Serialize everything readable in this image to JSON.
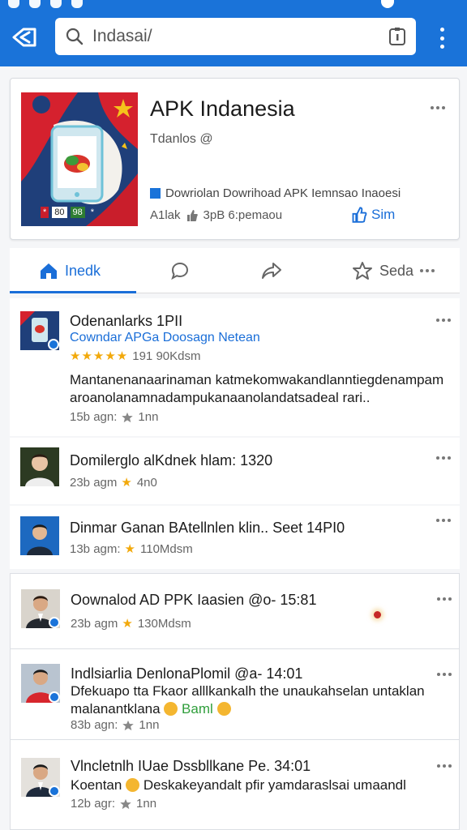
{
  "search": {
    "value": "Indasai/"
  },
  "app": {
    "title": "APK Indanesia",
    "subtitle": "Tdanlos @",
    "description": "Dowriolan  Dowrihoad APK  Iemnsao Inaoesi",
    "rating": "A1lak",
    "size": "3pB 6:pemaou",
    "action_label": "Sim",
    "art_chips": [
      "*",
      "80",
      "98",
      "*"
    ]
  },
  "tabs": [
    {
      "label": "Inedk",
      "icon": "home-icon",
      "active": true
    },
    {
      "label": "",
      "icon": "chat-icon"
    },
    {
      "label": "",
      "icon": "share-icon"
    },
    {
      "label": "Seda",
      "icon": "star-icon"
    }
  ],
  "feed": [
    {
      "title": "Odenanlarks 1PII",
      "link": "Cowndar APGa Doosagn Netean",
      "stars": "★★★★★",
      "stats": "191 90Kdsm",
      "body_line1": "Mantanenanaarinaman katmekomwakandlanntiegdenampam",
      "body_line2": "aroanolanamnadampukanaanolandatsadeal rari..",
      "time": "15b agn:",
      "reaction": "1nn"
    },
    {
      "title": "Domilerglo alKdnek hlam: 1320",
      "time": "23b agm",
      "reaction": "4n0"
    },
    {
      "title": "Dinmar Ganan BAtellnlen klin.. Seet 14PI0",
      "time": "13b agm:",
      "reaction": "110Mdsm"
    },
    {
      "title": "Oownalod AD PPK Iaasien @o- 15:81",
      "time": "23b agm",
      "reaction": "130Mdsm"
    },
    {
      "title": "Indlsiarlia DenlonaPlomil  @a- 14:01",
      "body_line1": "Dfekuapo tta Fkaor alllkankalh the unaukahselan untaklan",
      "body_line2": "malanantklana",
      "highlight": "Baml",
      "time": "83b agn:",
      "reaction": "1nn"
    },
    {
      "title": "Vlncletnlh IUae Dssbllkane  Pe. 34:01",
      "body_line1": "Koentan",
      "body_line1b": "Deskakeyandalt pfir yamdaraslsai umaandl",
      "time": "12b agr:",
      "reaction": "1nn"
    }
  ],
  "colors": {
    "primary": "#1a73d9",
    "link": "#1a6ed8",
    "star": "#f2a90b",
    "green": "#2f9e3b"
  }
}
